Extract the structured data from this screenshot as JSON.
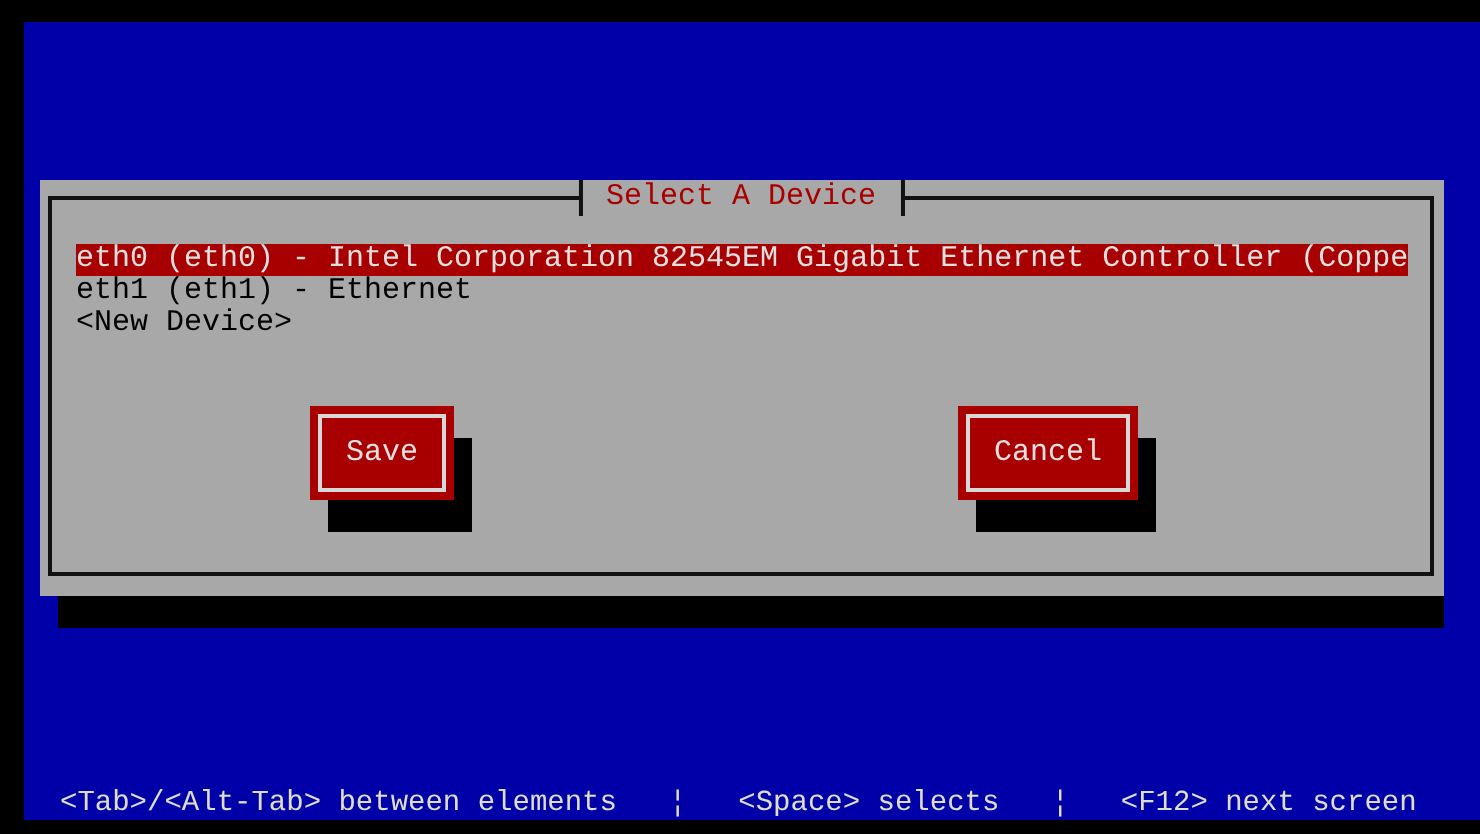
{
  "dialog": {
    "title": "Select A Device",
    "devices": [
      {
        "label": "eth0 (eth0) - Intel Corporation 82545EM Gigabit Ethernet Controller (Coppe",
        "selected": true
      },
      {
        "label": "eth1 (eth1) - Ethernet",
        "selected": false
      },
      {
        "label": "<New Device>",
        "selected": false
      }
    ],
    "buttons": [
      "Save",
      "Cancel"
    ]
  },
  "help_line": [
    "<Tab>/<Alt-Tab> between elements",
    "¦",
    "<Space> selects",
    "¦",
    "<F12> next screen"
  ]
}
